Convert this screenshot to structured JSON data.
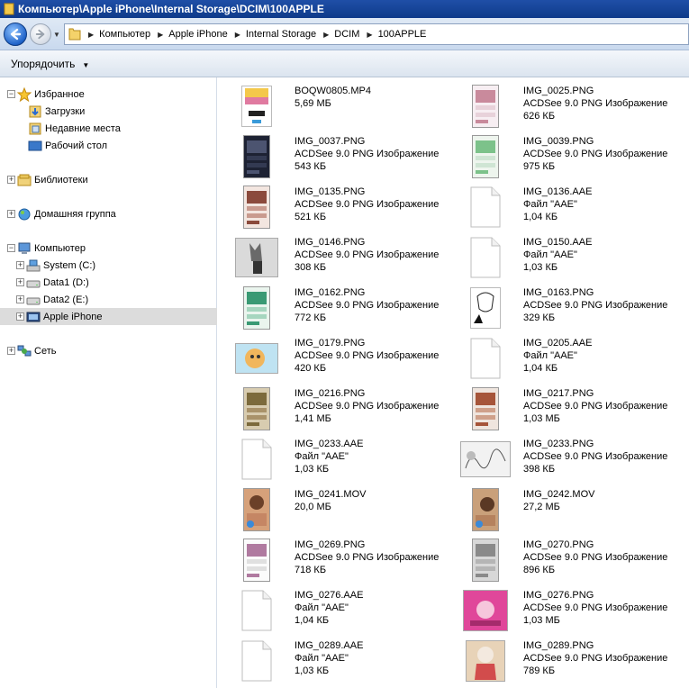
{
  "window": {
    "title": "Компьютер\\Apple iPhone\\Internal Storage\\DCIM\\100APPLE"
  },
  "address": {
    "crumbs": [
      "Компьютер",
      "Apple iPhone",
      "Internal Storage",
      "DCIM",
      "100APPLE"
    ]
  },
  "toolbar": {
    "organize_label": "Упорядочить"
  },
  "nav": {
    "favorites": "Избранное",
    "downloads": "Загрузки",
    "recent": "Недавние места",
    "desktop": "Рабочий стол",
    "libraries": "Библиотеки",
    "homegroup": "Домашняя группа",
    "computer": "Компьютер",
    "system": "System (C:)",
    "data1": "Data1 (D:)",
    "data2": "Data2 (E:)",
    "iphone": "Apple iPhone",
    "network": "Сеть"
  },
  "files": [
    {
      "name": "BOQW0805.MP4",
      "type": "",
      "size": "5,69 МБ",
      "kind": "video-screen"
    },
    {
      "name": "IMG_0025.PNG",
      "type": "ACDSee 9.0 PNG Изображение",
      "size": "626 КБ",
      "kind": "phone-pink"
    },
    {
      "name": "IMG_0037.PNG",
      "type": "ACDSee 9.0 PNG Изображение",
      "size": "543 КБ",
      "kind": "phone-dark"
    },
    {
      "name": "IMG_0039.PNG",
      "type": "ACDSee 9.0 PNG Изображение",
      "size": "975 КБ",
      "kind": "phone-green"
    },
    {
      "name": "IMG_0135.PNG",
      "type": "ACDSee 9.0 PNG Изображение",
      "size": "521 КБ",
      "kind": "phone-brown"
    },
    {
      "name": "IMG_0136.AAE",
      "type": "Файл \"AAE\"",
      "size": "1,04 КБ",
      "kind": "blank"
    },
    {
      "name": "IMG_0146.PNG",
      "type": "ACDSee 9.0 PNG Изображение",
      "size": "308 КБ",
      "kind": "wide-grey"
    },
    {
      "name": "IMG_0150.AAE",
      "type": "Файл \"AAE\"",
      "size": "1,03 КБ",
      "kind": "blank"
    },
    {
      "name": "IMG_0162.PNG",
      "type": "ACDSee 9.0 PNG Изображение",
      "size": "772 КБ",
      "kind": "phone-teal"
    },
    {
      "name": "IMG_0163.PNG",
      "type": "ACDSee 9.0 PNG Изображение",
      "size": "329 КБ",
      "kind": "sketch"
    },
    {
      "name": "IMG_0179.PNG",
      "type": "ACDSee 9.0 PNG Изображение",
      "size": "420 КБ",
      "kind": "wide-orange"
    },
    {
      "name": "IMG_0205.AAE",
      "type": "Файл \"AAE\"",
      "size": "1,04 КБ",
      "kind": "blank"
    },
    {
      "name": "IMG_0216.PNG",
      "type": "ACDSee 9.0 PNG Изображение",
      "size": "1,41 МБ",
      "kind": "phone-olive"
    },
    {
      "name": "IMG_0217.PNG",
      "type": "ACDSee 9.0 PNG Изображение",
      "size": "1,03 МБ",
      "kind": "phone-rust"
    },
    {
      "name": "IMG_0233.AAE",
      "type": "Файл \"AAE\"",
      "size": "1,03 КБ",
      "kind": "blank"
    },
    {
      "name": "IMG_0233.PNG",
      "type": "ACDSee 9.0 PNG Изображение",
      "size": "398 КБ",
      "kind": "wide-sketch"
    },
    {
      "name": "IMG_0241.MOV",
      "type": "",
      "size": "20,0 МБ",
      "kind": "phone-video"
    },
    {
      "name": "IMG_0242.MOV",
      "type": "",
      "size": "27,2 МБ",
      "kind": "phone-video2"
    },
    {
      "name": "IMG_0269.PNG",
      "type": "ACDSee 9.0 PNG Изображение",
      "size": "718 КБ",
      "kind": "phone-white"
    },
    {
      "name": "IMG_0270.PNG",
      "type": "ACDSee 9.0 PNG Изображение",
      "size": "896 КБ",
      "kind": "phone-grey"
    },
    {
      "name": "IMG_0276.AAE",
      "type": "Файл \"AAE\"",
      "size": "1,04 КБ",
      "kind": "blank"
    },
    {
      "name": "IMG_0276.PNG",
      "type": "ACDSee 9.0 PNG Изображение",
      "size": "1,03 МБ",
      "kind": "wide-pink"
    },
    {
      "name": "IMG_0289.AAE",
      "type": "Файл \"AAE\"",
      "size": "1,03 КБ",
      "kind": "blank"
    },
    {
      "name": "IMG_0289.PNG",
      "type": "ACDSee 9.0 PNG Изображение",
      "size": "789 КБ",
      "kind": "anime-tan"
    }
  ]
}
